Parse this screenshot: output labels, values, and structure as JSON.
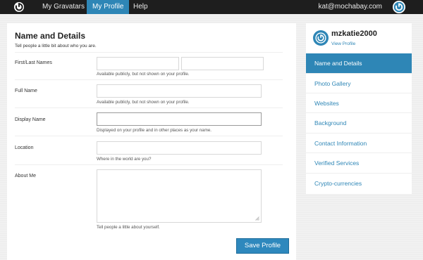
{
  "nav": {
    "items": [
      {
        "label": "My Gravatars"
      },
      {
        "label": "My Profile"
      },
      {
        "label": "Help"
      }
    ],
    "email": "kat@mochabay.com"
  },
  "form": {
    "title": "Name and Details",
    "subtitle": "Tell people a little bit about who you are.",
    "fields": {
      "first_last": {
        "label": "First/Last Names",
        "hint": "Available publicly, but not shown on your profile.",
        "first_value": "",
        "last_value": ""
      },
      "full_name": {
        "label": "Full Name",
        "hint": "Available publicly, but not shown on your profile.",
        "value": ""
      },
      "display_name": {
        "label": "Display Name",
        "hint": "Displayed on your profile and in other places as your name.",
        "value": ""
      },
      "location": {
        "label": "Location",
        "hint": "Where in the world are you?",
        "value": ""
      },
      "about_me": {
        "label": "About Me",
        "hint": "Tell people a little about yourself.",
        "value": ""
      }
    },
    "save_label": "Save Profile"
  },
  "sidebar": {
    "username": "mzkatie2000",
    "view_profile": "View Profile",
    "items": [
      {
        "label": "Name and Details",
        "active": true
      },
      {
        "label": "Photo Gallery",
        "active": false
      },
      {
        "label": "Websites",
        "active": false
      },
      {
        "label": "Background",
        "active": false
      },
      {
        "label": "Contact Information",
        "active": false
      },
      {
        "label": "Verified Services",
        "active": false
      },
      {
        "label": "Crypto-currencies",
        "active": false
      }
    ]
  },
  "colors": {
    "accent": "#2e86b6",
    "topbar": "#1e1e1e"
  },
  "icons": {
    "logo": "gravatar-logo-icon",
    "avatar": "gravatar-avatar-icon"
  }
}
